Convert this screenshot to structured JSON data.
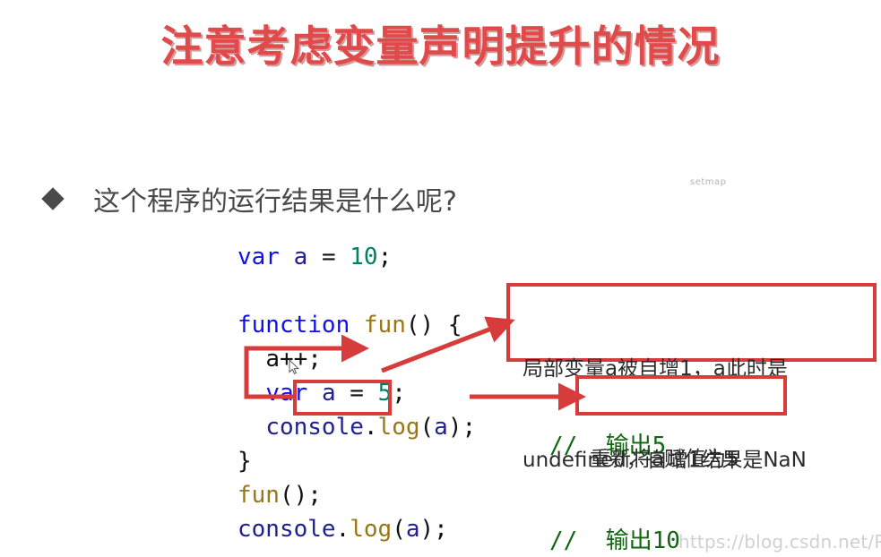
{
  "slide": {
    "title": "注意考虑变量声明提升的情况",
    "title_color": "#e04a4a",
    "background_color": "#ffffff"
  },
  "bullet": {
    "marker": "diamond-bullet",
    "text": "这个程序的运行结果是什么呢?"
  },
  "watermarks": {
    "top_right": "setmap",
    "bottom_right": "https://blog.csdn.net/Pakho_lin"
  },
  "code": {
    "language": "javascript",
    "lines": [
      {
        "id": "l1",
        "tokens": [
          {
            "t": "var",
            "c": "kw"
          },
          {
            "t": " ",
            "c": "punc"
          },
          {
            "t": "a",
            "c": "ident"
          },
          {
            "t": " ",
            "c": "punc"
          },
          {
            "t": "=",
            "c": "punc"
          },
          {
            "t": " ",
            "c": "punc"
          },
          {
            "t": "10",
            "c": "num"
          },
          {
            "t": ";",
            "c": "punc"
          }
        ]
      },
      {
        "id": "l2",
        "tokens": []
      },
      {
        "id": "l3",
        "tokens": [
          {
            "t": "function",
            "c": "kw"
          },
          {
            "t": " ",
            "c": "punc"
          },
          {
            "t": "fun",
            "c": "fn"
          },
          {
            "t": "() {",
            "c": "punc"
          }
        ]
      },
      {
        "id": "l4",
        "tokens": [
          {
            "t": "  ",
            "c": "punc"
          },
          {
            "t": "a++;",
            "c": "punc"
          }
        ]
      },
      {
        "id": "l5",
        "tokens": [
          {
            "t": "  ",
            "c": "punc"
          },
          {
            "t": "var",
            "c": "kw"
          },
          {
            "t": " ",
            "c": "punc"
          },
          {
            "t": "a",
            "c": "ident"
          },
          {
            "t": " ",
            "c": "punc"
          },
          {
            "t": "=",
            "c": "punc"
          },
          {
            "t": " ",
            "c": "punc"
          },
          {
            "t": "5",
            "c": "num"
          },
          {
            "t": ";",
            "c": "punc"
          }
        ]
      },
      {
        "id": "l6",
        "tokens": [
          {
            "t": "  ",
            "c": "punc"
          },
          {
            "t": "console",
            "c": "ident"
          },
          {
            "t": ".",
            "c": "punc"
          },
          {
            "t": "log",
            "c": "fn"
          },
          {
            "t": "(",
            "c": "punc"
          },
          {
            "t": "a",
            "c": "ident"
          },
          {
            "t": ");",
            "c": "punc"
          }
        ]
      },
      {
        "id": "l7",
        "tokens": [
          {
            "t": "}",
            "c": "punc"
          }
        ]
      },
      {
        "id": "l8",
        "tokens": [
          {
            "t": "fun",
            "c": "fn"
          },
          {
            "t": "();",
            "c": "punc"
          }
        ]
      },
      {
        "id": "l9",
        "tokens": [
          {
            "t": "console",
            "c": "ident"
          },
          {
            "t": ".",
            "c": "punc"
          },
          {
            "t": "log",
            "c": "fn"
          },
          {
            "t": "(",
            "c": "punc"
          },
          {
            "t": "a",
            "c": "ident"
          },
          {
            "t": ");",
            "c": "punc"
          }
        ]
      }
    ],
    "plain": [
      "var a = 10;",
      "",
      "function fun() {",
      "  a++;",
      "  var a = 5;",
      "  console.log(a);",
      "}",
      "fun();",
      "console.log(a);"
    ],
    "comments": [
      {
        "id": "c1",
        "text": "//  输出5",
        "for_line": "l6"
      },
      {
        "id": "c2",
        "text": "//  输出10",
        "for_line": "l9"
      }
    ],
    "colors": {
      "keyword": "#1010ef",
      "identifier": "#202090",
      "number": "#008060",
      "function": "#9a7615",
      "punctuation": "#111111",
      "comment": "#116611"
    }
  },
  "annotations": {
    "highlight_color": "#d73b3b",
    "highlight_box_label": "var a",
    "callouts": [
      {
        "id": "callout-1",
        "line1": "局部变量a被自增1，a此时是",
        "line2": "undefined，自增1结果是NaN"
      },
      {
        "id": "callout-2",
        "line1": "重新将a赋值为5"
      }
    ],
    "arrows": [
      {
        "id": "hoist-arrow",
        "desc": "elbow arrow from var-a box up to function body start"
      },
      {
        "id": "nan-arrow",
        "desc": "diagonal arrow from a++ to first callout"
      },
      {
        "id": "reassign-arrow",
        "desc": "horizontal arrow from var a = 5 to second callout"
      }
    ]
  }
}
